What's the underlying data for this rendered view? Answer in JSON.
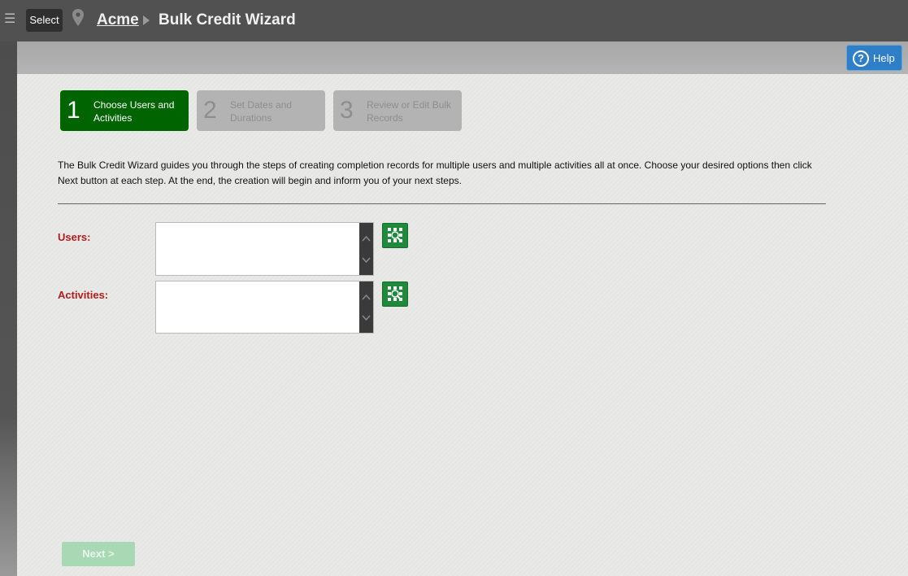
{
  "header": {
    "select_label": "Select",
    "breadcrumb_home": "Acme",
    "page_title": "Bulk Credit Wizard"
  },
  "toolbar": {
    "help_label": "Help",
    "help_glyph": "?"
  },
  "wizard": {
    "steps": [
      {
        "number": "1",
        "label": "Choose Users and Activities",
        "state": "active"
      },
      {
        "number": "2",
        "label": "Set Dates and Durations",
        "state": "inactive"
      },
      {
        "number": "3",
        "label": "Review or Edit Bulk Records",
        "state": "inactive"
      }
    ],
    "intro": "The Bulk Credit Wizard guides you through the steps of creating completion records for multiple users and multiple activities all at once. Choose your desired options then click Next button at each step. At the end, the creation will begin and inform you of your next steps."
  },
  "form": {
    "users_label": "Users:",
    "activities_label": "Activities:"
  },
  "footer": {
    "next_label": "Next >"
  },
  "colors": {
    "active_step": "#006400",
    "field_label": "#b01e1e",
    "help_button": "#2f7fc8",
    "picker_button": "#1f8a3c"
  },
  "icons": [
    "menu-icon",
    "location-pin-icon",
    "help-circle-icon",
    "picker-grid-icon",
    "scroll-up-icon",
    "scroll-down-icon"
  ]
}
